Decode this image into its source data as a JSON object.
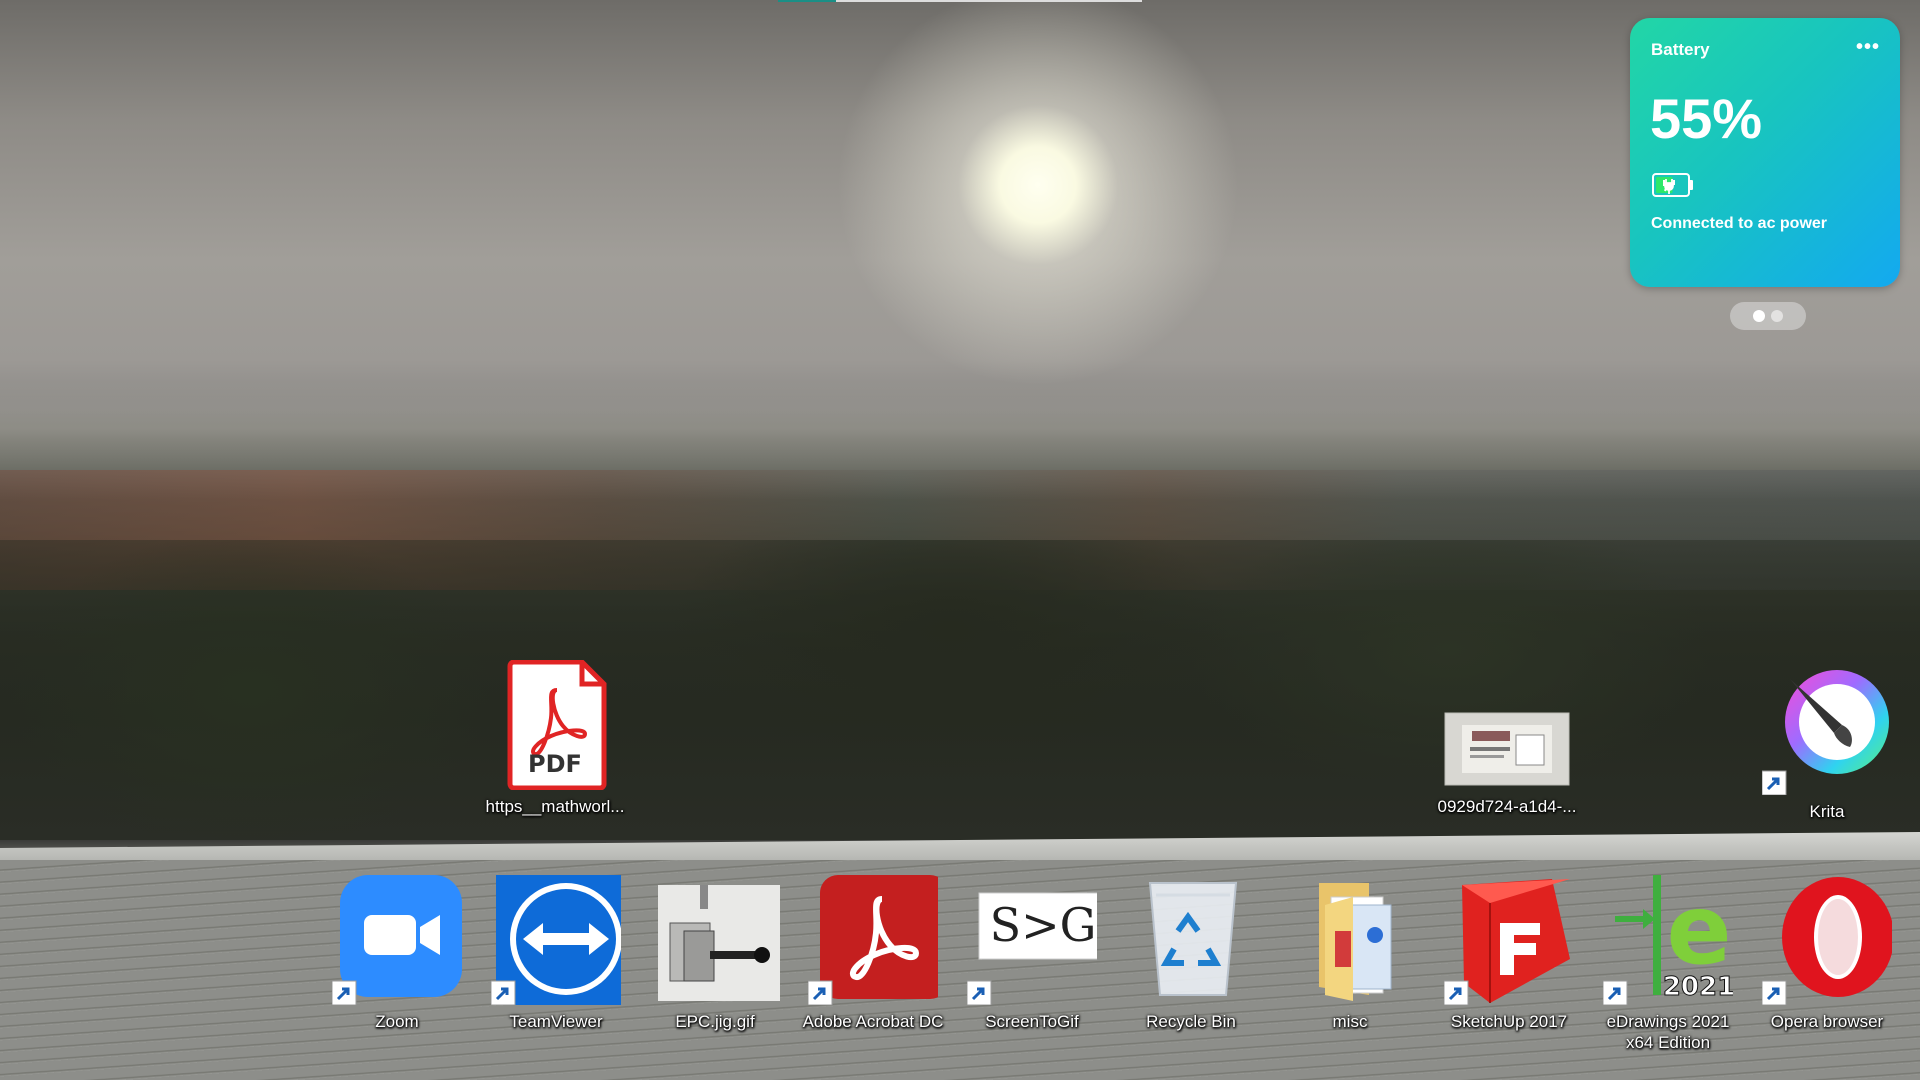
{
  "battery_widget": {
    "title": "Battery",
    "menu": "•••",
    "percent": "55%",
    "level": 0.55,
    "status": "Connected to ac power",
    "pages": 2,
    "active_page": 1
  },
  "top_progress": {
    "fraction": 0.16
  },
  "desktop_icons": {
    "pdf_file": {
      "label": "https__mathworl...",
      "icon": "pdf-file-icon"
    },
    "image_file": {
      "label": "0929d724-a1d4-...",
      "icon": "image-thumbnail-icon"
    },
    "krita": {
      "label": "Krita",
      "icon": "krita-icon"
    },
    "zoom": {
      "label": "Zoom",
      "icon": "zoom-icon"
    },
    "teamviewer": {
      "label": "TeamViewer",
      "icon": "teamviewer-icon"
    },
    "epc_jig": {
      "label": "EPC.jig.gif",
      "icon": "gif-thumbnail-icon"
    },
    "acrobat": {
      "label": "Adobe Acrobat DC",
      "icon": "acrobat-icon"
    },
    "screentogif": {
      "label": "ScreenToGif",
      "icon": "screentogif-icon",
      "logo_text": "S>G"
    },
    "recycle_bin": {
      "label": "Recycle Bin",
      "icon": "recycle-bin-icon"
    },
    "misc": {
      "label": "misc",
      "icon": "folder-icon"
    },
    "sketchup": {
      "label": "SketchUp 2017",
      "icon": "sketchup-icon"
    },
    "edrawings": {
      "label_line1": "eDrawings 2021",
      "label_line2": "x64 Edition",
      "icon": "edrawings-icon",
      "year_text": "2021"
    },
    "opera": {
      "label": "Opera browser",
      "icon": "opera-icon"
    }
  },
  "colors": {
    "widget_gradient_start": "#22d6a6",
    "widget_gradient_end": "#13a9f0",
    "battery_fill": "#2ee86a",
    "progress": "#1a8f86"
  }
}
